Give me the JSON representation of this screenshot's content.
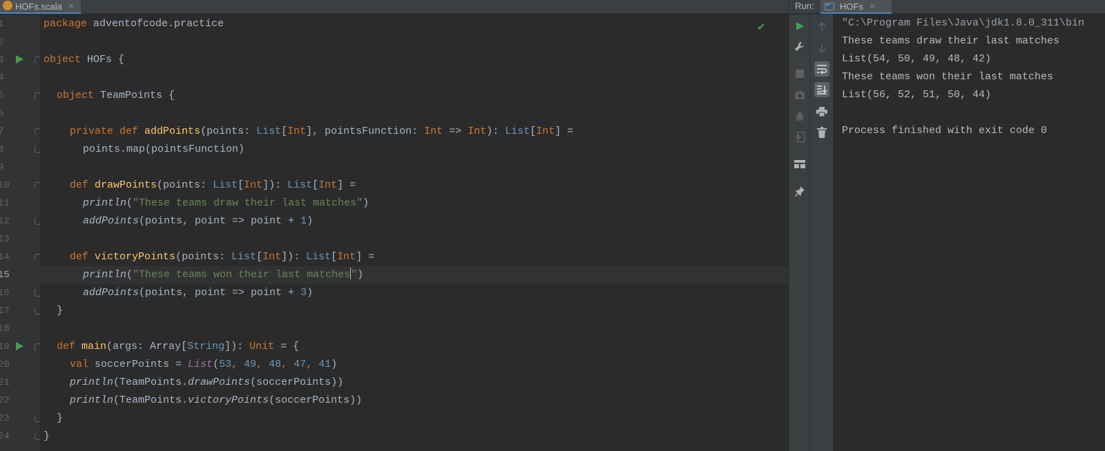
{
  "editor": {
    "tab": {
      "label": "HOFs.scala",
      "close": "✕"
    },
    "line_numbers": [
      "1",
      "2",
      "3",
      "4",
      "5",
      "6",
      "7",
      "8",
      "9",
      "10",
      "11",
      "12",
      "13",
      "14",
      "15",
      "16",
      "17",
      "18",
      "19",
      "20",
      "21",
      "22",
      "23",
      "24"
    ],
    "code": {
      "l1": {
        "kw": "package",
        "rest": " adventofcode.practice"
      },
      "l3": {
        "kw": "object",
        "rest": " HOFs {"
      },
      "l5": {
        "kw": "object",
        "rest": " TeamPoints {"
      },
      "l7": {
        "kw1": "private def",
        "fn": "addPoints",
        "p1": "(points: ",
        "t1": "List",
        "b1": "[",
        "t2": "Int",
        "b2": "], pointsFunction: ",
        "t3": "Int",
        "arrow": " => ",
        "t4": "Int",
        "p2": "): ",
        "t5": "List",
        "b3": "[",
        "t6": "Int",
        "b4": "] ="
      },
      "l8": {
        "text": "points.map(pointsFunction)"
      },
      "l10": {
        "kw": "def",
        "fn": "drawPoints",
        "p1": "(points: ",
        "t1": "List",
        "b1": "[",
        "t2": "Int",
        "b2": "]): ",
        "t3": "List",
        "b3": "[",
        "t4": "Int",
        "b4": "] ="
      },
      "l11": {
        "fn": "println",
        "p1": "(",
        "str": "\"These teams draw their last matches\"",
        "p2": ")"
      },
      "l12": {
        "fn": "addPoints",
        "p1": "(points, point => point + ",
        "num": "1",
        "p2": ")"
      },
      "l14": {
        "kw": "def",
        "fn": "victoryPoints",
        "p1": "(points: ",
        "t1": "List",
        "b1": "[",
        "t2": "Int",
        "b2": "]): ",
        "t3": "List",
        "b3": "[",
        "t4": "Int",
        "b4": "] ="
      },
      "l15": {
        "fn": "println",
        "p1": "(",
        "str_a": "\"These teams won their last matches",
        "str_b": "\"",
        "p2": ")"
      },
      "l16": {
        "fn": "addPoints",
        "p1": "(points, point => point + ",
        "num": "3",
        "p2": ")"
      },
      "l17": {
        "text": "}"
      },
      "l19": {
        "kw": "def",
        "fn": "main",
        "p1": "(args: Array[",
        "t1": "String",
        "p2": "]): ",
        "t2": "Unit",
        "p3": " = {"
      },
      "l20": {
        "kw": "val",
        "p1": " soccerPoints = ",
        "lst": "List",
        "p2": "(",
        "n1": "53",
        "c1": ", ",
        "n2": "49",
        "c2": ", ",
        "n3": "48",
        "c3": ", ",
        "n4": "47",
        "c4": ", ",
        "n5": "41",
        "p3": ")"
      },
      "l21": {
        "fn": "println",
        "p1": "(TeamPoints.",
        "fn2": "drawPoints",
        "p2": "(soccerPoints))"
      },
      "l22": {
        "fn": "println",
        "p1": "(TeamPoints.",
        "fn2": "victoryPoints",
        "p2": "(soccerPoints))"
      },
      "l23": {
        "text": "}"
      },
      "l24": {
        "text": "}"
      }
    }
  },
  "run": {
    "label": "Run:",
    "tab": {
      "label": "HOFs",
      "close": "✕"
    },
    "console": [
      "\"C:\\Program Files\\Java\\jdk1.8.0_311\\bin",
      "These teams draw their last matches",
      "List(54, 50, 49, 48, 42)",
      "These teams won their last matches",
      "List(56, 52, 51, 50, 44)",
      "",
      "Process finished with exit code 0"
    ]
  },
  "colors": {
    "background": "#2b2b2b",
    "keyword": "#cc7832",
    "string": "#6a8759",
    "number": "#6897bb",
    "function": "#ffc66d",
    "run_green": "#499c54"
  }
}
